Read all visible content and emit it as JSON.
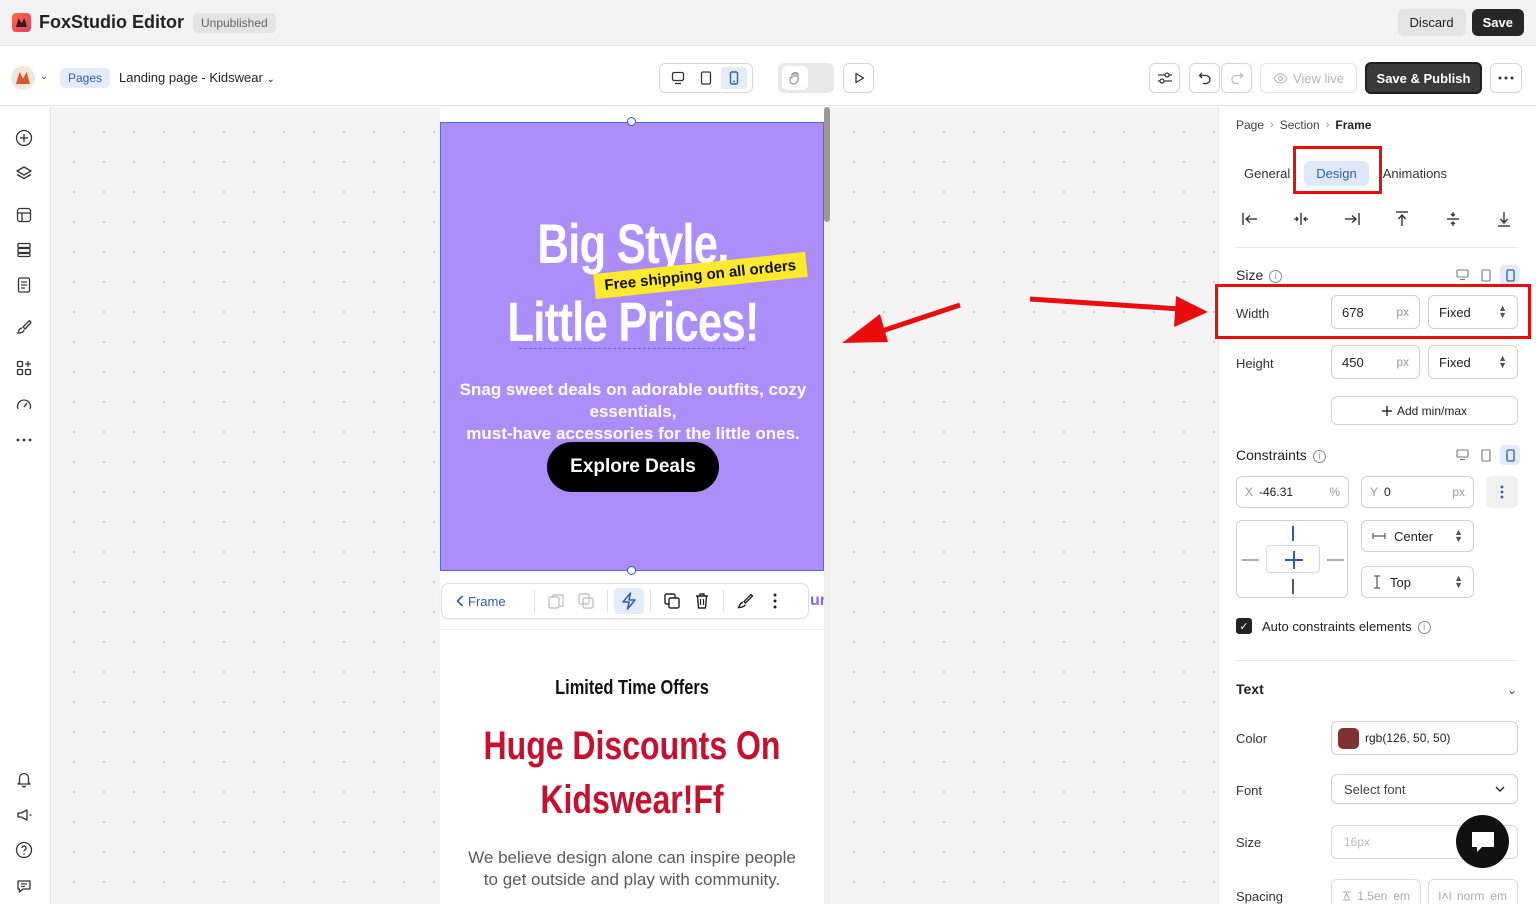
{
  "app": {
    "title": "FoxStudio Editor",
    "status": "Unpublished",
    "discard_label": "Discard",
    "save_label": "Save"
  },
  "toolbar": {
    "pages_label": "Pages",
    "page_name": "Landing page - Kidswear",
    "view_live_label": "View live",
    "save_publish_label": "Save & Publish"
  },
  "left_rail": {
    "icons": [
      "add-icon",
      "layers-icon",
      "sections-icon",
      "templates-icon",
      "pages-icon",
      "brush-icon",
      "apps-icon",
      "speed-icon",
      "more-icon",
      "bell-icon",
      "megaphone-icon",
      "help-icon",
      "chat-icon"
    ]
  },
  "canvas": {
    "hero_title_line1": "Big Style,",
    "hero_title_line2": "Little Prices!",
    "shipping_tag": "Free shipping on all orders",
    "hero_subtitle_line1": "Snag sweet deals on adorable outfits, cozy essentials,",
    "hero_subtitle_line2": "must-have accessories for the little ones.",
    "cta_label": "Explore Deals",
    "frame_toolbar_back": "Frame",
    "edge_text": "ur",
    "section2_kicker": "Limited Time Offers",
    "section2_heading_line1": "Huge Discounts On",
    "section2_heading_line2": "Kidswear!Ff",
    "section2_body_line1": "We believe design alone can inspire people",
    "section2_body_line2": "to get outside and play with community."
  },
  "panel": {
    "breadcrumb": [
      "Page",
      "Section",
      "Frame"
    ],
    "tabs": [
      "General",
      "Design",
      "Animations"
    ],
    "active_tab": "Design",
    "size_label": "Size",
    "width": {
      "label": "Width",
      "value": "678",
      "unit": "px",
      "mode": "Fixed"
    },
    "height": {
      "label": "Height",
      "value": "450",
      "unit": "px",
      "mode": "Fixed"
    },
    "add_minmax_label": "Add min/max",
    "constraints_label": "Constraints",
    "x": {
      "label": "X",
      "value": "-46.31",
      "unit": "%"
    },
    "y": {
      "label": "Y",
      "value": "0",
      "unit": "px"
    },
    "h_constraint": "Center",
    "v_constraint": "Top",
    "auto_constraints_label": "Auto constraints elements",
    "auto_constraints_checked": true,
    "text_section_label": "Text",
    "color": {
      "label": "Color",
      "value": "rgb(126, 50, 50)",
      "swatch": "#7e3232"
    },
    "font": {
      "label": "Font",
      "placeholder": "Select font"
    },
    "size": {
      "label": "Size",
      "placeholder": "16px"
    },
    "spacing": {
      "label": "Spacing",
      "line_height": "1.5en",
      "line_unit": "em",
      "letter": "norm",
      "letter_unit": "em"
    }
  },
  "colors": {
    "hero_bg": "#ad8dfa",
    "accent_blue": "#2d5fb5",
    "annotation_red": "#e90d0d",
    "heading_red": "#c70f2f",
    "shipping_yellow": "#fde92d"
  }
}
